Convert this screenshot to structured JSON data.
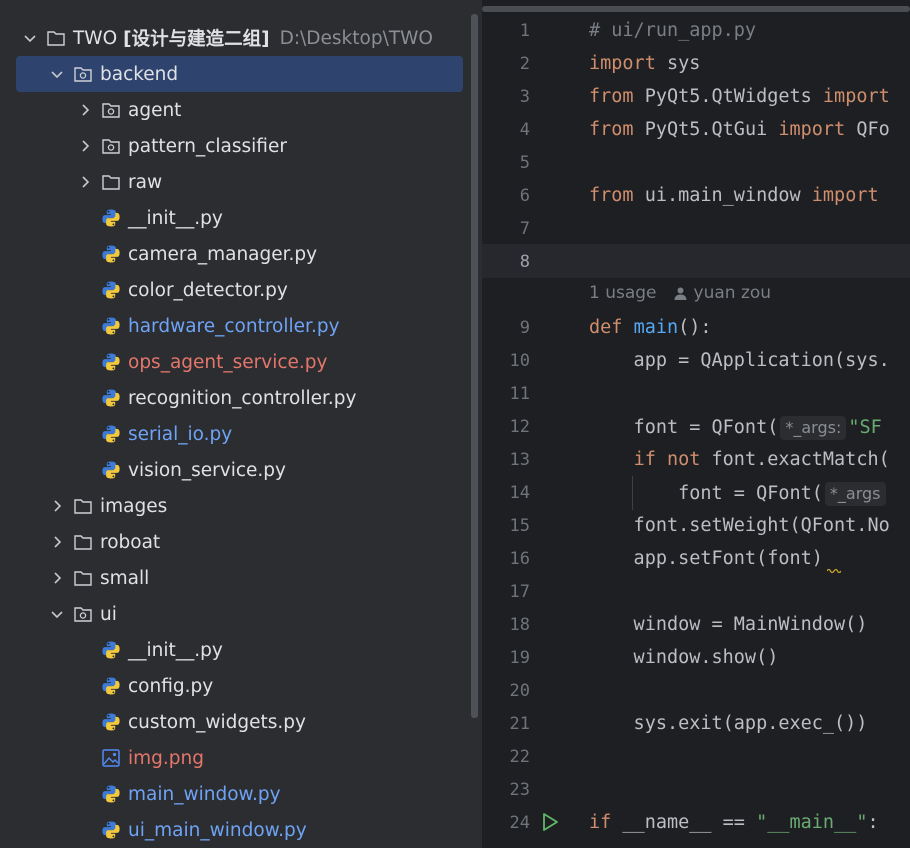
{
  "project": {
    "root_name": "TWO",
    "root_suffix": "[设计与建造二组]",
    "root_path": "D:\\Desktop\\TWO"
  },
  "tree": [
    {
      "label": "backend",
      "kind": "folder-module",
      "expanded": true,
      "depth": 1,
      "selected": true
    },
    {
      "label": "agent",
      "kind": "folder-module",
      "expanded": false,
      "depth": 2
    },
    {
      "label": "pattern_classifier",
      "kind": "folder-module",
      "expanded": false,
      "depth": 2
    },
    {
      "label": "raw",
      "kind": "folder",
      "expanded": false,
      "depth": 2
    },
    {
      "label": "__init__.py",
      "kind": "python",
      "depth": 2,
      "color": "normal"
    },
    {
      "label": "camera_manager.py",
      "kind": "python",
      "depth": 2,
      "color": "normal"
    },
    {
      "label": "color_detector.py",
      "kind": "python",
      "depth": 2,
      "color": "normal"
    },
    {
      "label": "hardware_controller.py",
      "kind": "python",
      "depth": 2,
      "color": "blue"
    },
    {
      "label": "ops_agent_service.py",
      "kind": "python",
      "depth": 2,
      "color": "red"
    },
    {
      "label": "recognition_controller.py",
      "kind": "python",
      "depth": 2,
      "color": "normal"
    },
    {
      "label": "serial_io.py",
      "kind": "python",
      "depth": 2,
      "color": "blue"
    },
    {
      "label": "vision_service.py",
      "kind": "python",
      "depth": 2,
      "color": "normal"
    },
    {
      "label": "images",
      "kind": "folder",
      "expanded": false,
      "depth": 1
    },
    {
      "label": "roboat",
      "kind": "folder",
      "expanded": false,
      "depth": 1
    },
    {
      "label": "small",
      "kind": "folder",
      "expanded": false,
      "depth": 1
    },
    {
      "label": "ui",
      "kind": "folder-module",
      "expanded": true,
      "depth": 1
    },
    {
      "label": "__init__.py",
      "kind": "python",
      "depth": 2,
      "color": "normal"
    },
    {
      "label": "config.py",
      "kind": "python",
      "depth": 2,
      "color": "normal"
    },
    {
      "label": "custom_widgets.py",
      "kind": "python",
      "depth": 2,
      "color": "normal"
    },
    {
      "label": "img.png",
      "kind": "image",
      "depth": 2,
      "color": "red"
    },
    {
      "label": "main_window.py",
      "kind": "python",
      "depth": 2,
      "color": "blue"
    },
    {
      "label": "ui_main_window.py",
      "kind": "python",
      "depth": 2,
      "color": "blue"
    }
  ],
  "editor": {
    "current_line": 8,
    "usage_hint": {
      "count": "1 usage",
      "author": "yuan zou"
    },
    "lines": [
      {
        "n": 1,
        "tokens": [
          [
            "cm",
            "# ui/run_app.py"
          ]
        ]
      },
      {
        "n": 2,
        "tokens": [
          [
            "kw",
            "import"
          ],
          [
            "",
            " sys"
          ]
        ]
      },
      {
        "n": 3,
        "tokens": [
          [
            "kw",
            "from"
          ],
          [
            "",
            " PyQt5.QtWidgets "
          ],
          [
            "kw",
            "import"
          ]
        ]
      },
      {
        "n": 4,
        "tokens": [
          [
            "kw",
            "from"
          ],
          [
            "",
            " PyQt5.QtGui "
          ],
          [
            "kw",
            "import"
          ],
          [
            "",
            " QFo"
          ]
        ]
      },
      {
        "n": 5,
        "tokens": []
      },
      {
        "n": 6,
        "tokens": [
          [
            "kw",
            "from"
          ],
          [
            "",
            " ui.main_window "
          ],
          [
            "kw",
            "import"
          ]
        ]
      },
      {
        "n": 7,
        "tokens": []
      },
      {
        "n": 8,
        "tokens": []
      },
      {
        "n": 9,
        "tokens": [
          [
            "kw",
            "def"
          ],
          [
            "",
            " "
          ],
          [
            "fn",
            "main"
          ],
          [
            "",
            "():"
          ]
        ]
      },
      {
        "n": 10,
        "tokens": [
          [
            "",
            "    app = QApplication(sys."
          ]
        ]
      },
      {
        "n": 11,
        "tokens": []
      },
      {
        "n": 12,
        "tokens": [
          [
            "",
            "    font = QFont("
          ],
          [
            "hint",
            "*_args:"
          ],
          [
            "st",
            "\"SF"
          ]
        ]
      },
      {
        "n": 13,
        "tokens": [
          [
            "",
            "    "
          ],
          [
            "kw",
            "if not"
          ],
          [
            "",
            " font.exactMatch("
          ]
        ]
      },
      {
        "n": 14,
        "tokens": [
          [
            "",
            "        font = QFont("
          ],
          [
            "hint",
            "*_args"
          ]
        ]
      },
      {
        "n": 15,
        "tokens": [
          [
            "",
            "    font.setWeight(QFont.No"
          ]
        ]
      },
      {
        "n": 16,
        "tokens": [
          [
            "",
            "    app.setFont(font)"
          ]
        ]
      },
      {
        "n": 17,
        "tokens": []
      },
      {
        "n": 18,
        "tokens": [
          [
            "",
            "    window = MainWindow()"
          ]
        ]
      },
      {
        "n": 19,
        "tokens": [
          [
            "",
            "    window.show()"
          ]
        ]
      },
      {
        "n": 20,
        "tokens": []
      },
      {
        "n": 21,
        "tokens": [
          [
            "",
            "    sys.exit(app.exec_())"
          ]
        ]
      },
      {
        "n": 22,
        "tokens": []
      },
      {
        "n": 23,
        "tokens": []
      },
      {
        "n": 24,
        "tokens": [
          [
            "kw",
            "if"
          ],
          [
            "",
            " __name__ == "
          ],
          [
            "st",
            "\"__main__\""
          ],
          [
            "",
            ":"
          ]
        ]
      }
    ]
  },
  "colors": {
    "selection": "#2e436e",
    "keyword": "#cf8e6d",
    "function": "#56a8f5",
    "string": "#6aab73",
    "modified": "#6fa3f5",
    "untracked": "#e5766b"
  }
}
